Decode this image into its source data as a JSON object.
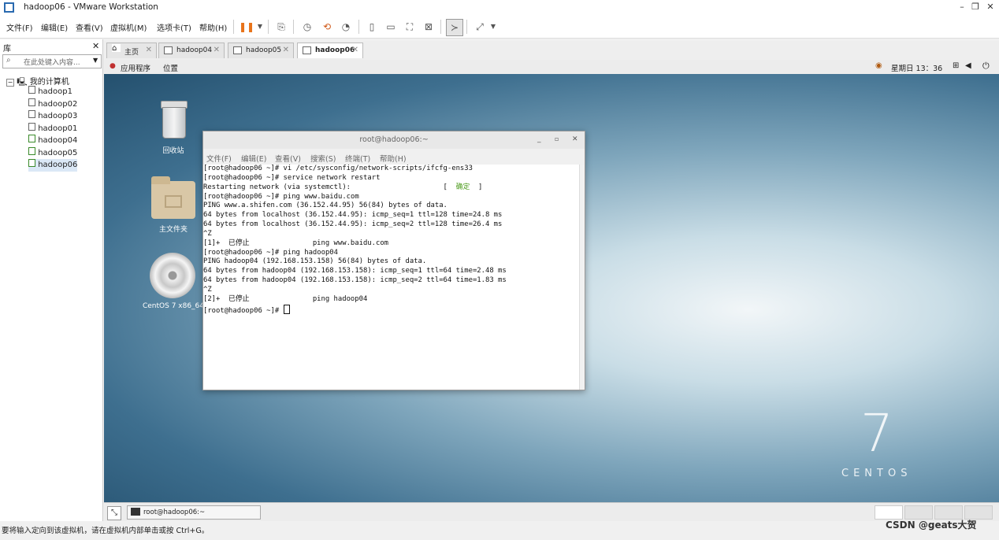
{
  "window": {
    "title": "hadoop06 - VMware Workstation"
  },
  "menu": [
    "文件(F)",
    "编辑(E)",
    "查看(V)",
    "虚拟机(M)",
    "选项卡(T)",
    "帮助(H)"
  ],
  "library": {
    "header": "库",
    "search_placeholder": "在此处键入内容...",
    "root": "我的计算机",
    "vms": [
      "hadoop1",
      "hadoop02",
      "hadoop03",
      "hadoop01",
      "hadoop04",
      "hadoop05",
      "hadoop06"
    ]
  },
  "tabs": [
    "主页",
    "hadoop04",
    "hadoop05",
    "hadoop06"
  ],
  "gnome": {
    "apps": "应用程序",
    "places": "位置",
    "clock": "星期日 13：36"
  },
  "desktop": {
    "icons": [
      "回收站",
      "主文件夹",
      "CentOS 7 x86_64"
    ],
    "brand_number": "7",
    "brand_name": "CENTOS"
  },
  "terminal": {
    "title": "root@hadoop06:~",
    "menu": [
      "文件(F)",
      "编辑(E)",
      "查看(V)",
      "搜索(S)",
      "终端(T)",
      "帮助(H)"
    ],
    "lines": [
      "[root@hadoop06 ~]# vi /etc/sysconfig/network-scripts/ifcfg-ens33",
      "[root@hadoop06 ~]# service network restart",
      "Restarting network (via systemctl):                      [  确定  ]",
      "[root@hadoop06 ~]# ping www.baidu.com",
      "PING www.a.shifen.com (36.152.44.95) 56(84) bytes of data.",
      "64 bytes from localhost (36.152.44.95): icmp_seq=1 ttl=128 time=24.8 ms",
      "64 bytes from localhost (36.152.44.95): icmp_seq=2 ttl=128 time=26.4 ms",
      "^Z",
      "[1]+  已停止               ping www.baidu.com",
      "[root@hadoop06 ~]# ping hadoop04",
      "PING hadoop04 (192.168.153.158) 56(84) bytes of data.",
      "64 bytes from hadoop04 (192.168.153.158): icmp_seq=1 ttl=64 time=2.48 ms",
      "64 bytes from hadoop04 (192.168.153.158): icmp_seq=2 ttl=64 time=1.83 ms",
      "^Z",
      "[2]+  已停止               ping hadoop04",
      "[root@hadoop06 ~]# "
    ]
  },
  "taskbar": {
    "item": "root@hadoop06:~"
  },
  "statusbar": {
    "text": "要将输入定向到该虚拟机，请在虚拟机内部单击或按 Ctrl+G。",
    "watermark": "CSDN @geats大贺"
  },
  "colors": {
    "ok_green": "#4a9a1a",
    "pause_orange": "#e8731a"
  }
}
